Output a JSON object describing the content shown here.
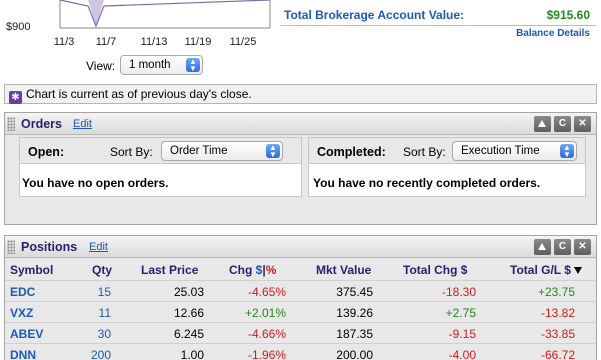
{
  "chart": {
    "y_tick": "$900",
    "x_ticks": [
      "11/3",
      "11/7",
      "11/13",
      "11/19",
      "11/25"
    ],
    "fill_color": "#cfc5e2",
    "line_color": "#7e6aaa",
    "view_label": "View:",
    "view_value": "1 month"
  },
  "balance": {
    "label": "Total Brokerage Account Value:",
    "value": "$915.60",
    "details_link": "Balance Details"
  },
  "notice": {
    "icon": "star-icon",
    "text": "Chart is current as of previous day's close."
  },
  "orders": {
    "title": "Orders",
    "edit": "Edit",
    "controls": [
      "collapse-icon",
      "refresh-icon",
      "close-icon"
    ],
    "open": {
      "title": "Open:",
      "sort_label": "Sort By:",
      "sort_value": "Order Time",
      "message": "You have no open orders."
    },
    "completed": {
      "title": "Completed:",
      "sort_label": "Sort By:",
      "sort_value": "Execution Time",
      "message": "You have no recently completed orders."
    }
  },
  "positions": {
    "title": "Positions",
    "edit": "Edit",
    "controls": [
      "collapse-icon",
      "refresh-icon",
      "close-icon"
    ],
    "headers": {
      "symbol": "Symbol",
      "qty": "Qty",
      "last_price": "Last Price",
      "chg": "Chg",
      "chg_dollar": "$",
      "chg_sep": "|",
      "chg_pct": "%",
      "mkt_value": "Mkt Value",
      "total_chg": "Total Chg $",
      "total_gl": "Total G/L $"
    },
    "rows": [
      {
        "symbol": "EDC",
        "qty": "15",
        "last_price": "25.03",
        "chg": "-4.65%",
        "mkt_value": "375.45",
        "total_chg": "-18.30",
        "total_gl": "+23.75"
      },
      {
        "symbol": "VXZ",
        "qty": "11",
        "last_price": "12.66",
        "chg": "+2.01%",
        "mkt_value": "139.26",
        "total_chg": "+2.75",
        "total_gl": "-13.82"
      },
      {
        "symbol": "ABEV",
        "qty": "30",
        "last_price": "6.245",
        "chg": "-4.66%",
        "mkt_value": "187.35",
        "total_chg": "-9.15",
        "total_gl": "-33.85"
      },
      {
        "symbol": "DNN",
        "qty": "200",
        "last_price": "1.00",
        "chg": "-1.96%",
        "mkt_value": "200.00",
        "total_chg": "-4.00",
        "total_gl": "-66.72"
      }
    ]
  }
}
